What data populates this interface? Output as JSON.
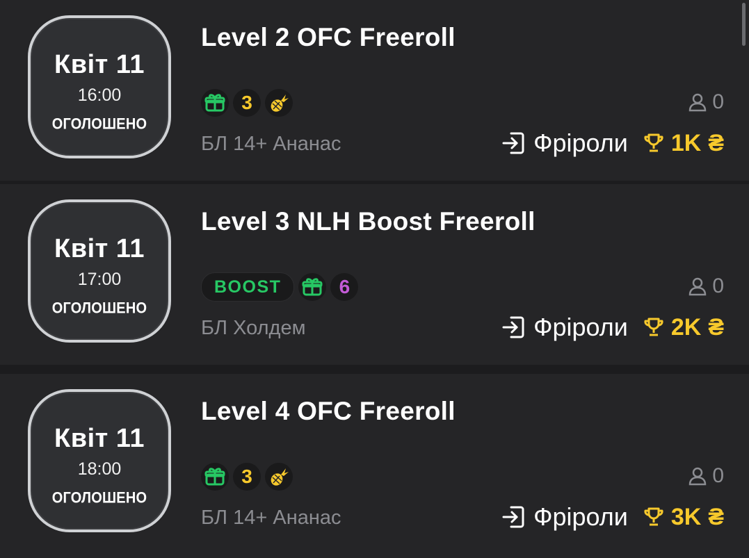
{
  "colors": {
    "background": "#1c1c1e",
    "card": "#252527",
    "accent_yellow": "#f7c92c",
    "accent_green": "#27c864",
    "accent_purple": "#c35bd6",
    "muted_text": "#8c8d92"
  },
  "tournaments": [
    {
      "date_day": "Квіт 11",
      "date_time": "16:00",
      "status": "ОГОЛОШЕНО",
      "title": "Level 2 OFC Freeroll",
      "badges": {
        "boost_label": "",
        "gift_icon": "gift-icon",
        "count": "3",
        "count_color": "#f7c92c",
        "extra_icon": "pineapple-icon"
      },
      "game_type": "БЛ 14+ Ананас",
      "players": "0",
      "entry_type": "Фріроли",
      "prize": "1K"
    },
    {
      "date_day": "Квіт 11",
      "date_time": "17:00",
      "status": "ОГОЛОШЕНО",
      "title": "Level 3 NLH Boost Freeroll",
      "badges": {
        "boost_label": "BOOST",
        "gift_icon": "gift-icon",
        "count": "6",
        "count_color": "#c35bd6",
        "extra_icon": ""
      },
      "game_type": "БЛ Холдем",
      "players": "0",
      "entry_type": "Фріроли",
      "prize": "2K"
    },
    {
      "date_day": "Квіт 11",
      "date_time": "18:00",
      "status": "ОГОЛОШЕНО",
      "title": "Level 4 OFC Freeroll",
      "badges": {
        "boost_label": "",
        "gift_icon": "gift-icon",
        "count": "3",
        "count_color": "#f7c92c",
        "extra_icon": "pineapple-icon"
      },
      "game_type": "БЛ 14+ Ананас",
      "players": "0",
      "entry_type": "Фріроли",
      "prize": "3K"
    }
  ],
  "currency_symbol": "₴"
}
